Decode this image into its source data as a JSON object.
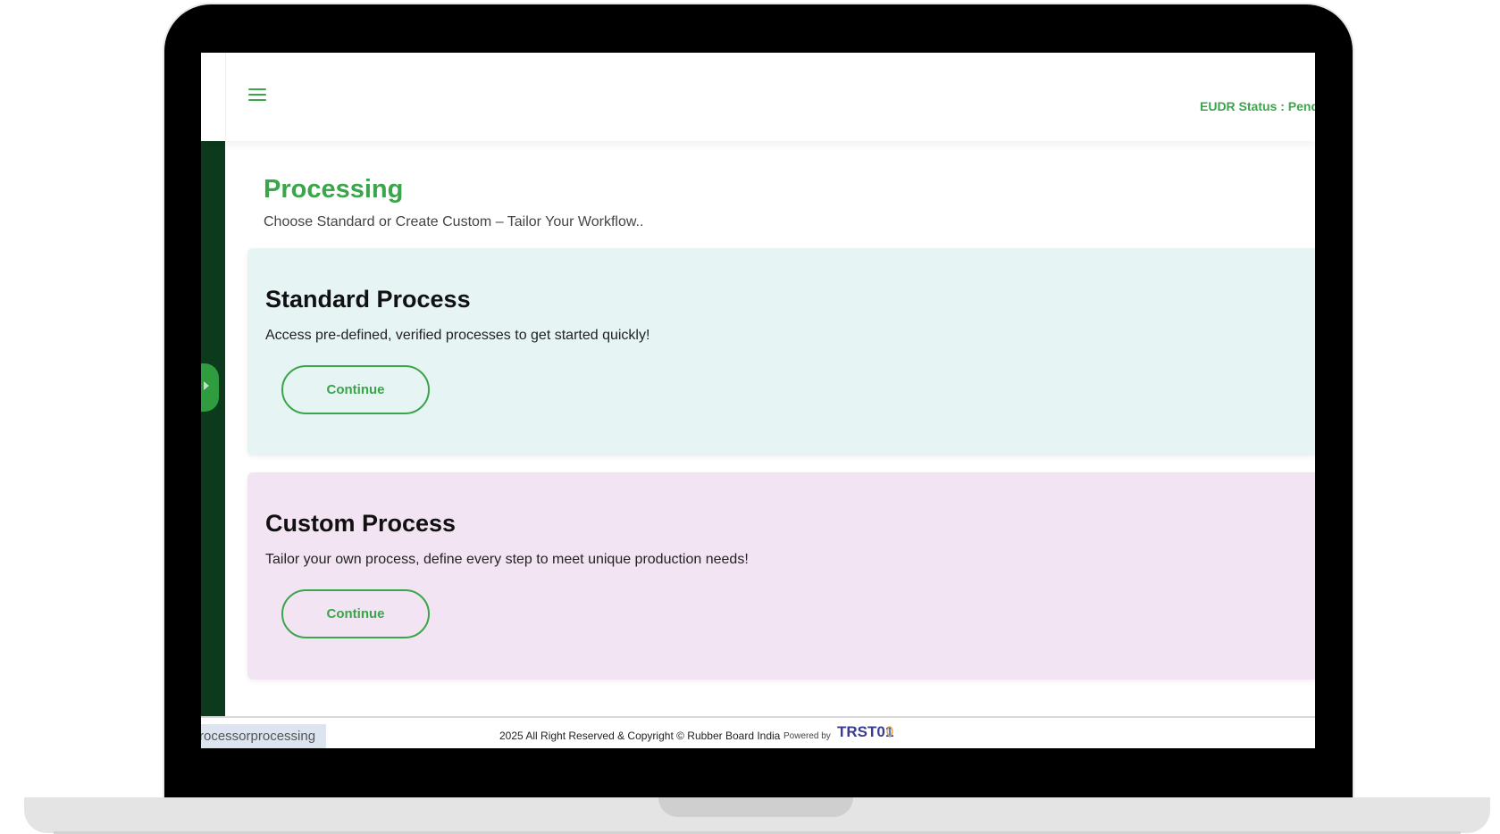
{
  "header": {
    "eudr_status": "EUDR Status : Pendi"
  },
  "page": {
    "title": "Processing",
    "subtitle": "Choose Standard or Create Custom – Tailor Your Workflow.."
  },
  "cards": [
    {
      "title": "Standard Process",
      "description": "Access pre-defined, verified processes to get started quickly!",
      "button_label": "Continue"
    },
    {
      "title": "Custom Process",
      "description": "Tailor your own process, define every step to meet unique production needs!",
      "button_label": "Continue"
    }
  ],
  "footer": {
    "copyright": "2025 All Right Reserved & Copyright © Rubber Board India",
    "powered_by": "Powered by",
    "brand": "TRST01"
  },
  "status_bar": {
    "url": "rocessorprocessing"
  },
  "colors": {
    "accent": "#3aa54a",
    "sidebar": "#0b3a1d",
    "standard_card_bg": "#e6f4f4",
    "custom_card_bg": "#f3e4f3"
  },
  "icons": {
    "menu": "hamburger-menu-icon",
    "sidebar_toggle": "chevron-right-icon",
    "brand": "leaf-icon"
  }
}
